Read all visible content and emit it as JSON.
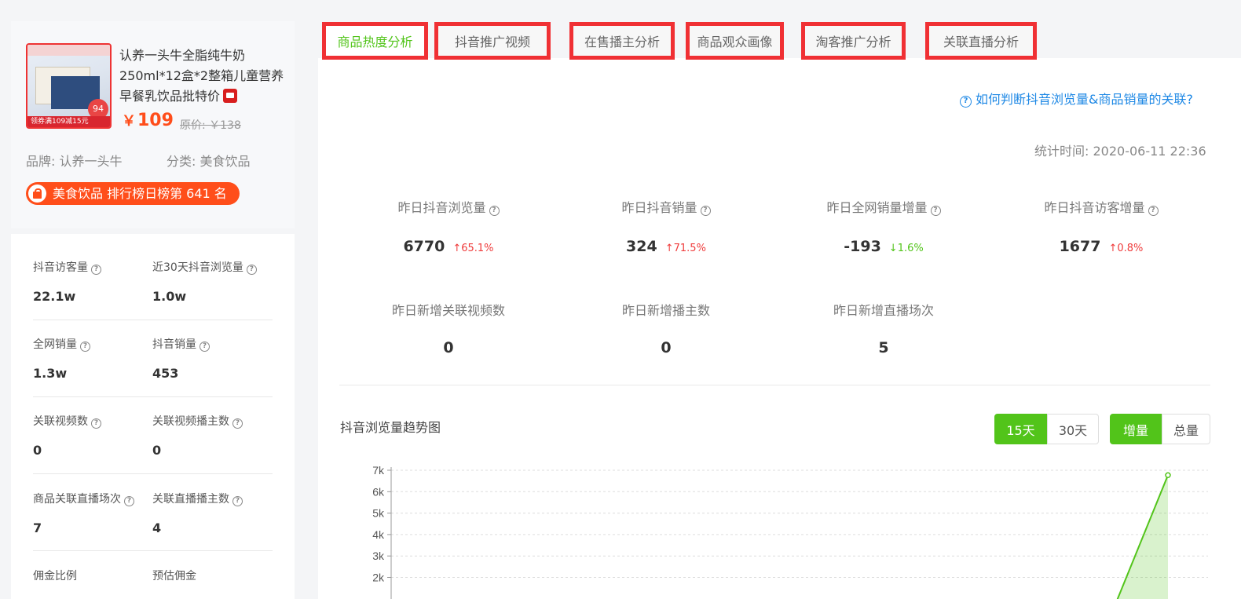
{
  "product": {
    "title": "认养一头牛全脂纯牛奶250ml*12盒*2整箱儿童营养早餐乳饮品批特价",
    "price_symbol": "￥",
    "price": "109",
    "original_price": "原价: ￥138",
    "brand": "品牌: 认养一头牛",
    "category": "分类: 美食饮品",
    "rank": "美食饮品 排行榜日榜第 641 名",
    "tmall_icon": "tmall-icon",
    "thumb_badge": "94",
    "thumb_strip": "领券满109减15元"
  },
  "left_stats": [
    {
      "label": "抖音访客量",
      "value": "22.1w",
      "help": true
    },
    {
      "label": "近30天抖音浏览量",
      "value": "1.0w",
      "help": true
    },
    {
      "label": "全网销量",
      "value": "1.3w",
      "help": true
    },
    {
      "label": "抖音销量",
      "value": "453",
      "help": true
    },
    {
      "label": "关联视频数",
      "value": "0",
      "help": true
    },
    {
      "label": "关联视频播主数",
      "value": "0",
      "help": true
    },
    {
      "label": "商品关联直播场次",
      "value": "7",
      "help": true
    },
    {
      "label": "关联直播播主数",
      "value": "4",
      "help": true
    },
    {
      "label": "佣金比例",
      "value": "",
      "help": false
    },
    {
      "label": "预估佣金",
      "value": "",
      "help": false
    }
  ],
  "tabs": [
    {
      "label": "商品热度分析",
      "active": true
    },
    {
      "label": "抖音推广视频",
      "active": false
    },
    {
      "label": "在售播主分析",
      "active": false
    },
    {
      "label": "商品观众画像",
      "active": false
    },
    {
      "label": "淘客推广分析",
      "active": false
    },
    {
      "label": "关联直播分析",
      "active": false
    }
  ],
  "help_link": "如何判断抖音浏览量&商品销量的关联?",
  "stat_time": "统计时间: 2020-06-11 22:36",
  "metrics": [
    {
      "label": "昨日抖音浏览量",
      "value": "6770",
      "change": "65.1%",
      "direction": "up",
      "help": true
    },
    {
      "label": "昨日抖音销量",
      "value": "324",
      "change": "71.5%",
      "direction": "up",
      "help": true
    },
    {
      "label": "昨日全网销量增量",
      "value": "-193",
      "change": "1.6%",
      "direction": "down",
      "help": true
    },
    {
      "label": "昨日抖音访客增量",
      "value": "1677",
      "change": "0.8%",
      "direction": "up",
      "help": true
    },
    {
      "label": "昨日新增关联视频数",
      "value": "0",
      "change": "",
      "direction": "",
      "help": false
    },
    {
      "label": "昨日新增播主数",
      "value": "0",
      "change": "",
      "direction": "",
      "help": false
    },
    {
      "label": "昨日新增直播场次",
      "value": "5",
      "change": "",
      "direction": "",
      "help": false
    }
  ],
  "chart_title": "抖音浏览量趋势图",
  "range_buttons": [
    {
      "label": "15天",
      "on": true
    },
    {
      "label": "30天",
      "on": false
    }
  ],
  "mode_buttons": [
    {
      "label": "增量",
      "on": true
    },
    {
      "label": "总量",
      "on": false
    }
  ],
  "colors": {
    "accent_green": "#52c41a",
    "price_orange": "#ff4d1a",
    "highlight_red": "#f03034",
    "link_blue": "#1e88e5",
    "up_red": "#ef3b3b"
  },
  "chart_data": {
    "type": "area",
    "title": "抖音浏览量趋势图",
    "y_ticks": [
      "2k",
      "3k",
      "4k",
      "5k",
      "6k",
      "7k"
    ],
    "ylim": [
      0,
      7000
    ],
    "grid": true,
    "series": [
      {
        "values": [
          6770
        ]
      }
    ]
  }
}
